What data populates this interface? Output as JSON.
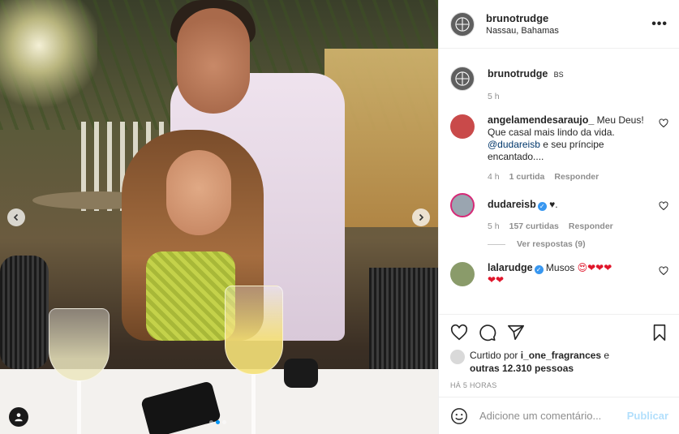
{
  "post": {
    "username": "brunotrudge",
    "location": "Nassau, Bahamas",
    "more_label": "•••",
    "image_dots": {
      "count": 3,
      "active": 2
    }
  },
  "caption": {
    "username": "brunotrudge",
    "tag": "BS",
    "time": "5 h"
  },
  "comments": [
    {
      "username": "angelamendesaraujo_",
      "text_before": " Meu Deus! Que casal mais lindo da vida. ",
      "mention": "@dudareisb",
      "text_after": " e seu príncipe encantado....",
      "time": "4 h",
      "likes": "1 curtida",
      "reply": "Responder"
    },
    {
      "username": "dudareisb",
      "text": "♥.",
      "time": "5 h",
      "likes": "157 curtidas",
      "reply": "Responder",
      "view_replies": "Ver respostas (9)"
    },
    {
      "username": "lalarudge",
      "text": "Musos",
      "emojis_line1": "😍❤❤❤",
      "emojis_line2": "❤❤"
    }
  ],
  "likes": {
    "prefix": "Curtido por ",
    "liker": "i_one_fragrances",
    "middle": " e ",
    "count_text": "outras 12.310 pessoas"
  },
  "timestamp": "HÁ 5 HORAS",
  "add_comment": {
    "placeholder": "Adicione um comentário...",
    "publish": "Publicar"
  },
  "colors": {
    "accent": "#0095f6",
    "verified": "#3897f0",
    "publish_disabled": "#b2dffc",
    "muted": "#8e8e8e"
  }
}
